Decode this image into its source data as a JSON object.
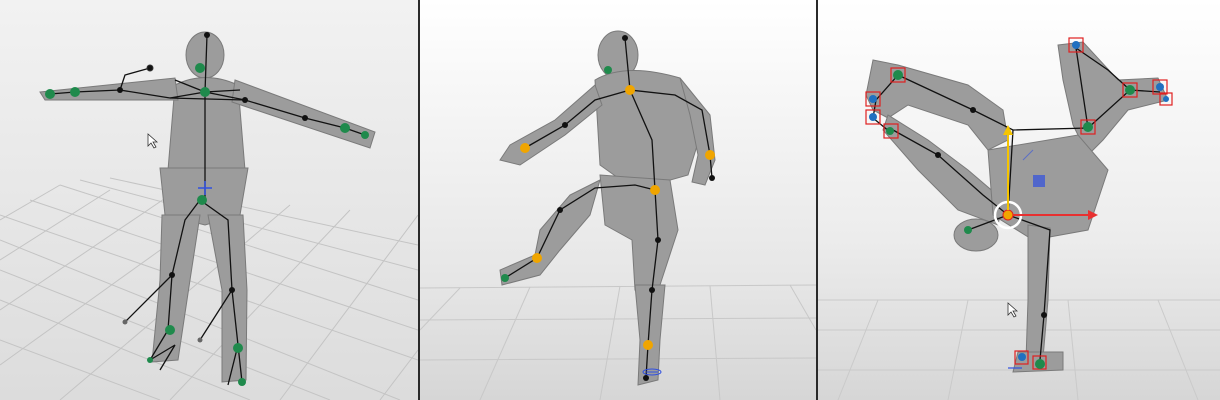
{
  "viewports": [
    {
      "pose": "t-pose",
      "rig_color": "#1f8a4c"
    },
    {
      "pose": "crouch-kick",
      "rig_color": "#f0a500"
    },
    {
      "pose": "one-hand-handstand",
      "rig_color": "#1f8a4c"
    }
  ],
  "colors": {
    "background_top": "#f0f0f0",
    "background_bottom": "#d8d8d8",
    "grid": "#bdbdbd",
    "mannequin": "#9a9a9a",
    "bone": "#111111",
    "joint_green": "#1f8a4c",
    "joint_yellow": "#f0a500",
    "selection_red": "#e02020",
    "gizmo_y": "#f5c400",
    "gizmo_x": "#e83030",
    "gizmo_z": "#3050e0"
  },
  "icons": [
    "mouse-cursor-icon",
    "rotate-gizmo-icon",
    "move-gizmo-icon"
  ]
}
